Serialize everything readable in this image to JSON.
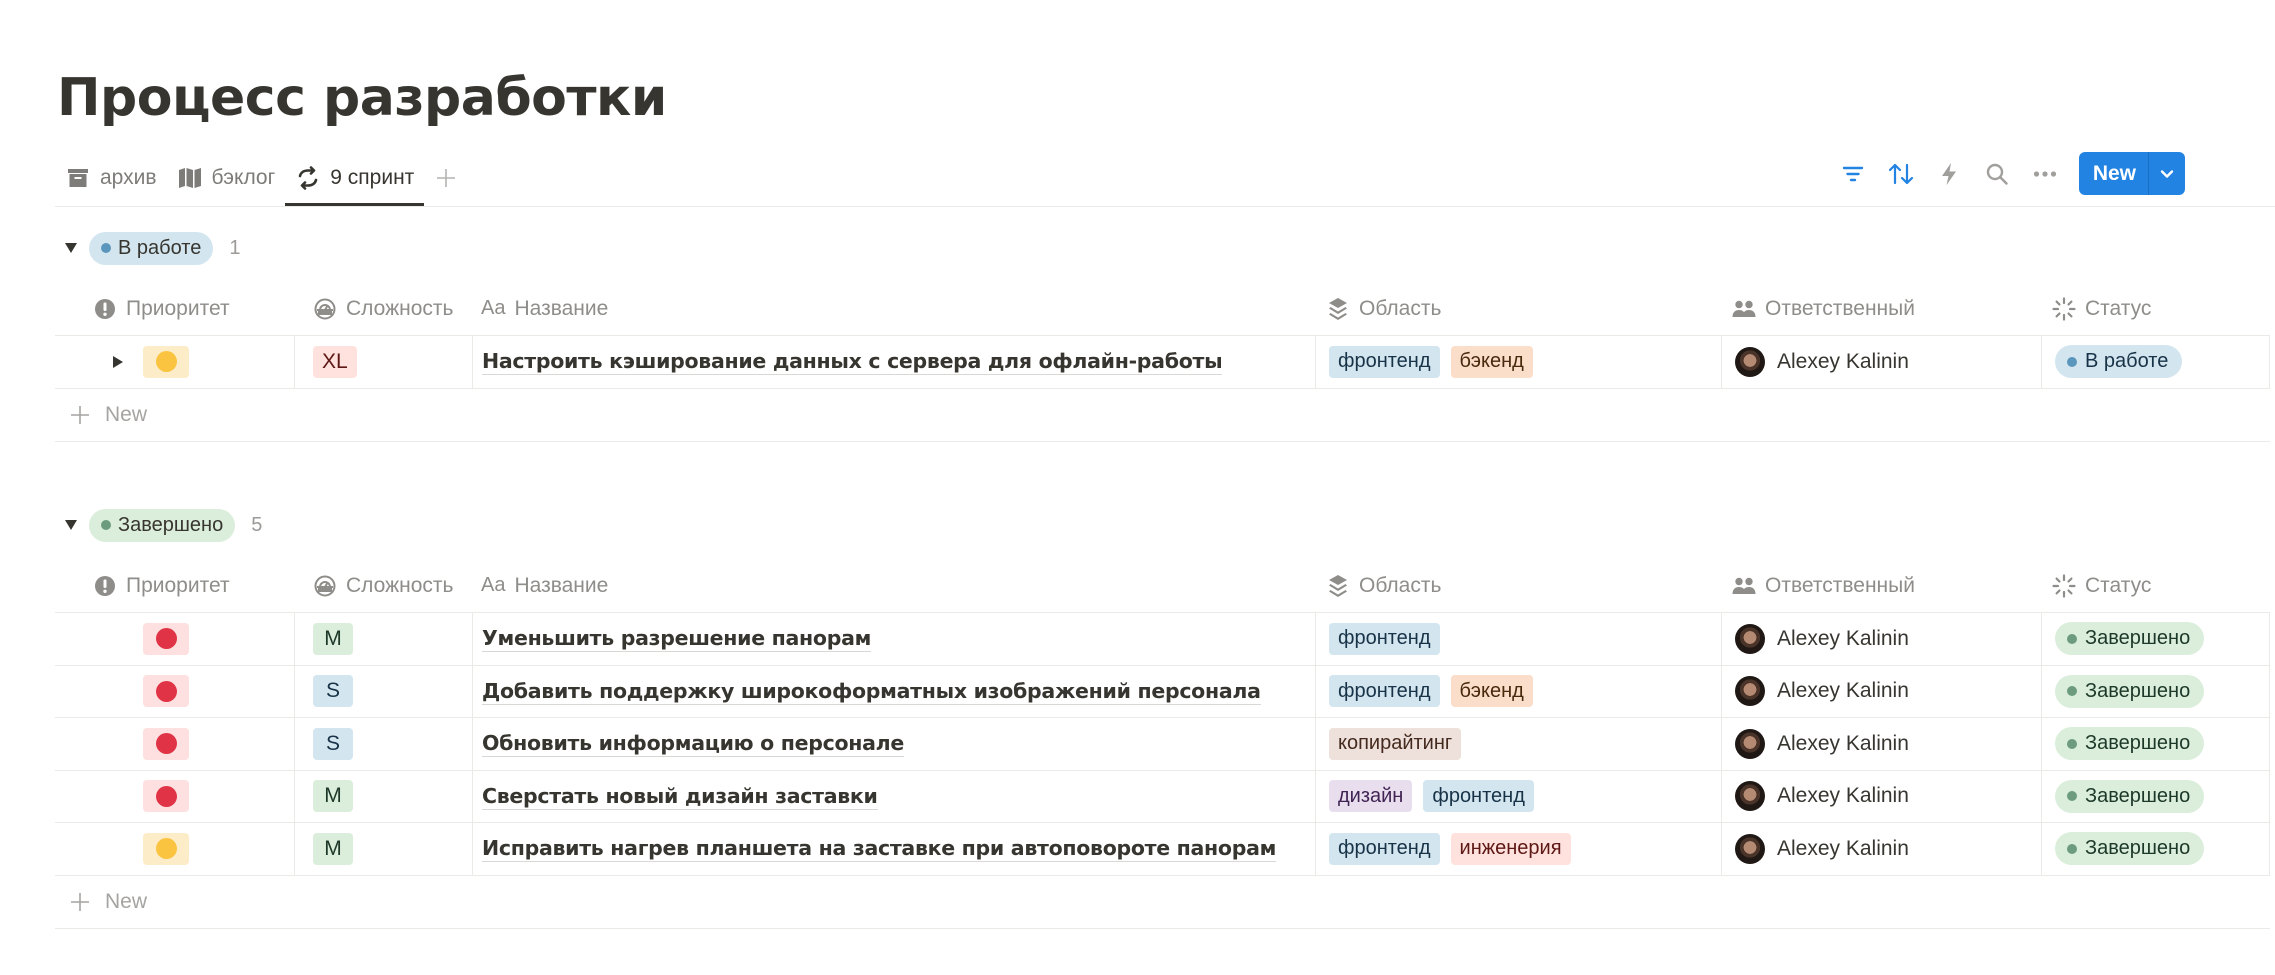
{
  "page": {
    "title": "Процесс разработки"
  },
  "views": {
    "tabs": [
      {
        "label": "архив",
        "icon": "archive-icon",
        "active": false
      },
      {
        "label": "бэклог",
        "icon": "map-icon",
        "active": false
      },
      {
        "label": "9 спринт",
        "icon": "refresh-icon",
        "active": true
      }
    ],
    "add_icon": "plus-icon"
  },
  "toolbar": {
    "icons": [
      "filter-icon",
      "sort-icon",
      "lightning-icon",
      "search-icon",
      "more-icon"
    ],
    "new_label": "New",
    "accent_color": "#2383e2"
  },
  "columns": [
    {
      "label": "Приоритет",
      "icon": "exclamation-icon"
    },
    {
      "label": "Сложность",
      "icon": "gauge-icon"
    },
    {
      "label": "Название",
      "icon": "text-icon",
      "icon_text": "Aa"
    },
    {
      "label": "Область",
      "icon": "layers-icon"
    },
    {
      "label": "Ответственный",
      "icon": "people-icon"
    },
    {
      "label": "Статус",
      "icon": "status-loader-icon"
    }
  ],
  "groups": [
    {
      "label": "В работе",
      "count": "1",
      "pill_bg": "#d3e5ef",
      "dot_color": "#5b97bd",
      "rows": [
        {
          "priority": "medium",
          "complexity": "XL",
          "name": "Настроить кэширование данных с сервера для офлайн-работы",
          "areas": [
            "фронтенд",
            "бэкенд"
          ],
          "owner": "Alexey Kalinin",
          "status": "В работе"
        }
      ],
      "new_label": "New"
    },
    {
      "label": "Завершено",
      "count": "5",
      "pill_bg": "#dbeddb",
      "dot_color": "#6c9b7d",
      "rows": [
        {
          "priority": "high",
          "complexity": "M",
          "name": "Уменьшить разрешение панорам",
          "areas": [
            "фронтенд"
          ],
          "owner": "Alexey Kalinin",
          "status": "Завершено"
        },
        {
          "priority": "high",
          "complexity": "S",
          "name": "Добавить поддержку широкоформатных изображений персонала",
          "areas": [
            "фронтенд",
            "бэкенд"
          ],
          "owner": "Alexey Kalinin",
          "status": "Завершено"
        },
        {
          "priority": "high",
          "complexity": "S",
          "name": "Обновить информацию о персонале",
          "areas": [
            "копирайтинг"
          ],
          "owner": "Alexey Kalinin",
          "status": "Завершено"
        },
        {
          "priority": "high",
          "complexity": "M",
          "name": "Сверстать новый дизайн заставки",
          "areas": [
            "дизайн",
            "фронтенд"
          ],
          "owner": "Alexey Kalinin",
          "status": "Завершено"
        },
        {
          "priority": "medium",
          "complexity": "M",
          "name": "Исправить нагрев планшета на заставке при автоповороте панорам",
          "areas": [
            "фронтенд",
            "инженерия"
          ],
          "owner": "Alexey Kalinin",
          "status": "Завершено"
        }
      ],
      "new_label": "New"
    }
  ],
  "colors": {
    "priority": {
      "high": {
        "bg": "#fde0df",
        "dot": "#e03345"
      },
      "medium": {
        "bg": "#fdecc8",
        "dot": "#fac440"
      }
    },
    "complexity": {
      "XL": {
        "bg": "#ffe2dd",
        "fg": "#5d1715"
      },
      "M": {
        "bg": "#dbeddb",
        "fg": "#1c3829"
      },
      "S": {
        "bg": "#d3e5ef",
        "fg": "#183347"
      }
    },
    "areas": {
      "фронтенд": {
        "bg": "#d3e5ef",
        "fg": "#183347"
      },
      "бэкенд": {
        "bg": "#fadec9",
        "fg": "#49290e"
      },
      "копирайтинг": {
        "bg": "#eee0da",
        "fg": "#442a1e"
      },
      "дизайн": {
        "bg": "#e8deee",
        "fg": "#412454"
      },
      "инженерия": {
        "bg": "#ffe2dd",
        "fg": "#5d1715"
      }
    },
    "status": {
      "В работе": {
        "bg": "#d3e5ef",
        "dot": "#5b97bd",
        "fg": "#183347"
      },
      "Завершено": {
        "bg": "#dbeddb",
        "dot": "#6c9b7d",
        "fg": "#1c3829"
      }
    }
  }
}
